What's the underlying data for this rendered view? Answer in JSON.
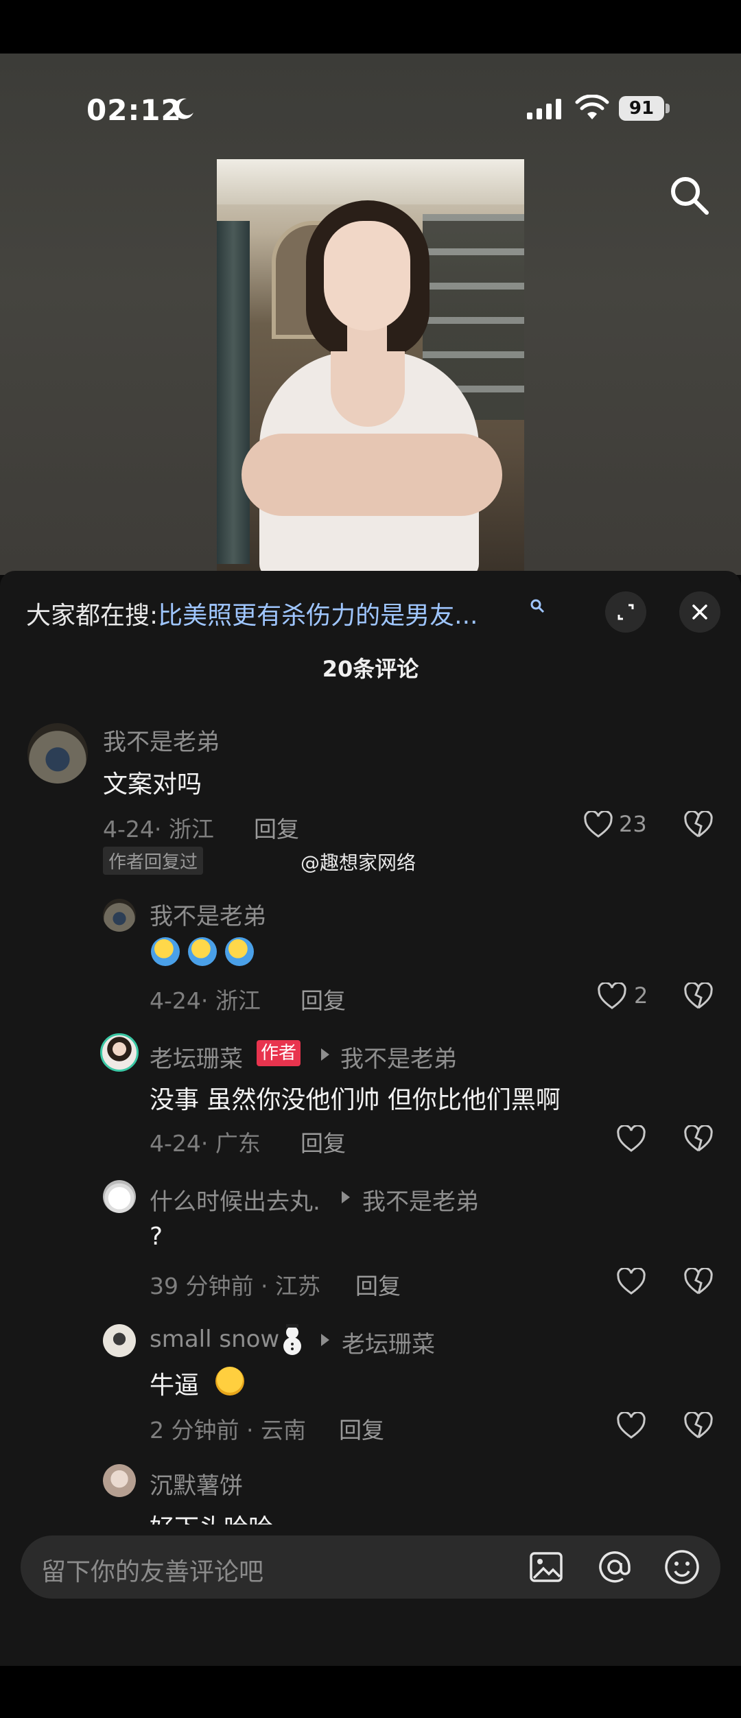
{
  "status_bar": {
    "time": "02:12",
    "battery": "91"
  },
  "hot_search": {
    "prefix": "大家都在搜:",
    "link": "比美照更有杀伤力的是男友..."
  },
  "comments_count": "20条评论",
  "comments": [
    {
      "user": "我不是老弟",
      "text": "文案对吗",
      "meta": "4-24· 浙江",
      "reply": "回复",
      "likes": "23",
      "author_replied": "作者回复过"
    },
    {
      "user": "我不是老弟",
      "text": "",
      "meta": "4-24· 浙江",
      "reply": "回复",
      "likes": "2"
    },
    {
      "user": "老坛珊菜",
      "badge": "作者",
      "reply_to": "我不是老弟",
      "text": "没事 虽然你没他们帅 但你比他们黑啊",
      "meta": "4-24· 广东",
      "reply": "回复"
    },
    {
      "user": "什么时候出去丸.",
      "reply_to": "我不是老弟",
      "text": "?",
      "meta": "39 分钟前 · 江苏",
      "reply": "回复"
    },
    {
      "user": "small snow",
      "reply_to": "老坛珊菜",
      "text": "牛逼",
      "meta": "2 分钟前 · 云南",
      "reply": "回复"
    },
    {
      "user": "沉默薯饼",
      "text": "好下头哈哈"
    }
  ],
  "watermark": "@趣想家网络",
  "input": {
    "placeholder": "留下你的友善评论吧"
  },
  "colors": {
    "link": "#9fc6ff",
    "badge": "#e8344e",
    "panel": "#161616"
  }
}
